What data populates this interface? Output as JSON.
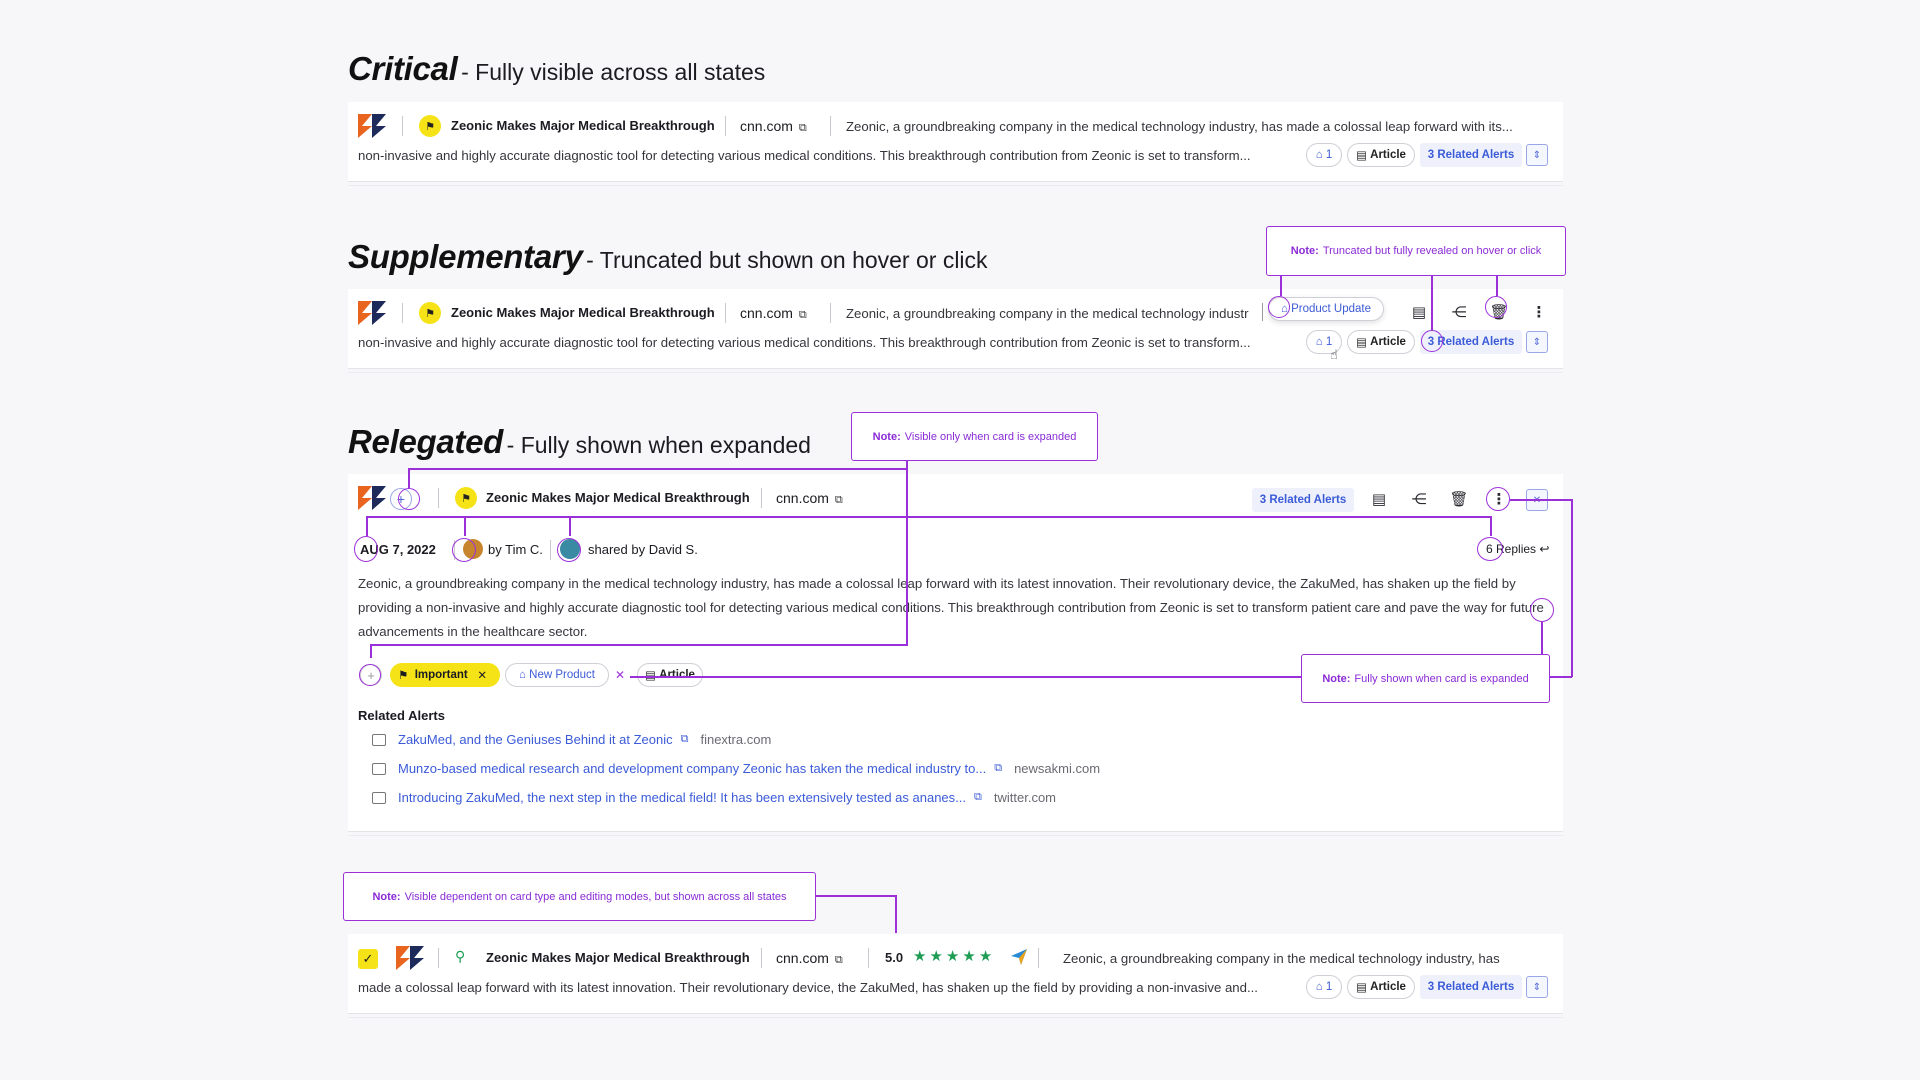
{
  "sections": {
    "critical": {
      "title": "Critical",
      "subtitle": "- Fully visible across all states"
    },
    "supplementary": {
      "title": "Supplementary",
      "subtitle": "- Truncated but shown on hover or click"
    },
    "relegated": {
      "title": "Relegated",
      "subtitle": "- Fully shown when expanded"
    }
  },
  "card": {
    "headline": "Zeonic Makes Major Medical Breakthrough",
    "domain": "cnn.com",
    "summary_line1": "Zeonic, a groundbreaking company in the medical technology industry, has made a colossal leap forward with its...",
    "summary_line1_short": "Zeonic, a groundbreaking company in the medical technology industr",
    "summary_line2": "non-invasive and highly accurate diagnostic tool for detecting various medical conditions. This breakthrough contribution from Zeonic is set to transform...",
    "tag_count": "1",
    "article_label": "Article",
    "related_label": "3 Related Alerts",
    "product_update_label": "Product Update"
  },
  "expanded": {
    "date": "AUG 7, 2022",
    "author": "by Tim C.",
    "shared": "shared by David S.",
    "replies": "6 Replies",
    "body": "Zeonic, a groundbreaking company in the medical technology industry, has made a colossal leap forward with its latest innovation. Their revolutionary device, the ZakuMed, has shaken up the field by providing a non-invasive and highly accurate diagnostic tool for detecting various medical conditions. This breakthrough contribution from Zeonic is set to transform patient care and pave the way for future advancements in the healthcare sector.",
    "tags": [
      "Important",
      "New Product",
      "Article"
    ],
    "related_heading": "Related Alerts",
    "related_alerts": [
      {
        "title": "ZakuMed, and the Geniuses Behind it at Zeonic",
        "domain": "finextra.com"
      },
      {
        "title": "Munzo-based medical research and development company Zeonic has taken the medical industry to...",
        "domain": "newsakmi.com"
      },
      {
        "title": "Introducing ZakuMed, the next step in the medical field! It has been extensively tested as ananes...",
        "domain": "twitter.com"
      }
    ]
  },
  "fourth_card": {
    "rating": "5.0",
    "summary_line1": "Zeonic, a groundbreaking company in the medical technology industry, has",
    "summary_line2": "made a colossal leap forward with its latest innovation. Their revolutionary device, the ZakuMed, has shaken up the field by providing a non-invasive and..."
  },
  "notes": {
    "prefix": "Note:",
    "truncated": "Truncated but fully revealed on hover or click",
    "expanded_only": "Visible only when card is expanded",
    "fully_shown": "Fully shown when card is expanded",
    "dependent": "Visible dependent on card type and editing modes, but shown across all states"
  },
  "colors": {
    "accent": "#9b30d9",
    "link": "#3b5bd8",
    "flag_yellow": "#f5e317",
    "star_green": "#1f9d55"
  },
  "icons": [
    "zeonic-logo-icon",
    "flag-icon",
    "external-link-icon",
    "tag-icon",
    "article-icon",
    "expand-icon",
    "share-icon",
    "trash-icon",
    "more-icon",
    "plus-icon",
    "close-icon",
    "reply-icon",
    "star-icon",
    "location-pin-icon",
    "send-icon",
    "check-icon"
  ]
}
